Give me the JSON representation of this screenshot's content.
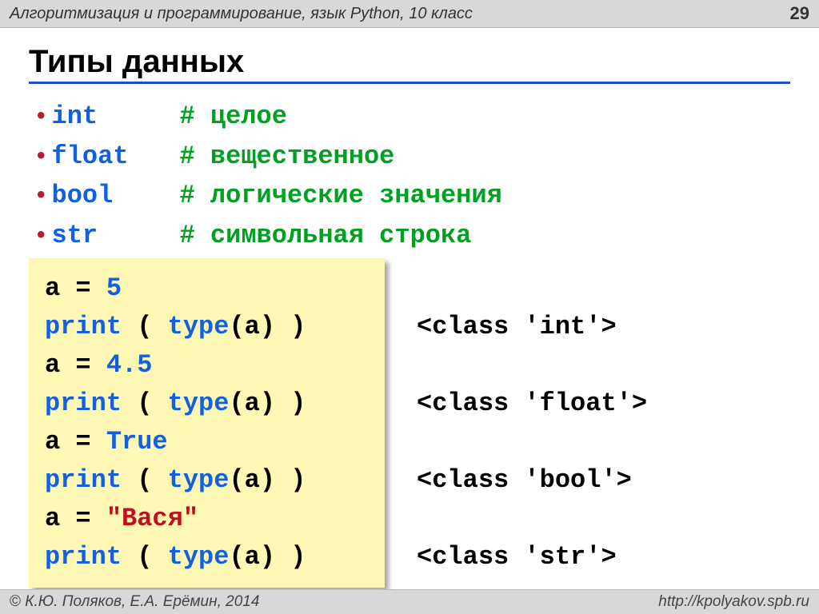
{
  "header": {
    "subject": "Алгоритмизация и программирование, язык Python, 10 класс",
    "page": "29"
  },
  "title": "Типы данных",
  "types": [
    {
      "name": "int",
      "pad": "        ",
      "comment": "# целое"
    },
    {
      "name": "float",
      "pad": "  ",
      "comment": "# вещественное"
    },
    {
      "name": "bool",
      "pad": "   ",
      "comment": "# логические значения"
    },
    {
      "name": "str",
      "pad": "    ",
      "comment": "# символьная строка"
    }
  ],
  "code": {
    "l1_a": "a = ",
    "l1_b": "5",
    "l2_a": "print",
    "l2_b": " ( ",
    "l2_c": "type",
    "l2_d": "(a) )",
    "l3_a": "a = ",
    "l3_b": "4.5",
    "l4_a": "print",
    "l4_b": " ( ",
    "l4_c": "type",
    "l4_d": "(a) )",
    "l5_a": "a = ",
    "l5_b": "True",
    "l6_a": "print",
    "l6_b": " ( ",
    "l6_c": "type",
    "l6_d": "(a) )",
    "l7_a": "a = ",
    "l7_b": "\"Вася\"",
    "l8_a": "print",
    "l8_b": " ( ",
    "l8_c": "type",
    "l8_d": "(a) )"
  },
  "output": {
    "o1": "",
    "o2": "<class 'int'>",
    "o3": "",
    "o4": "<class 'float'>",
    "o5": "",
    "o6": "<class 'bool'>",
    "o7": "",
    "o8": "<class 'str'>"
  },
  "footer": {
    "authors": " К.Ю. Поляков, Е.А. Ерёмин, 2014",
    "url": "http://kpolyakov.spb.ru"
  }
}
